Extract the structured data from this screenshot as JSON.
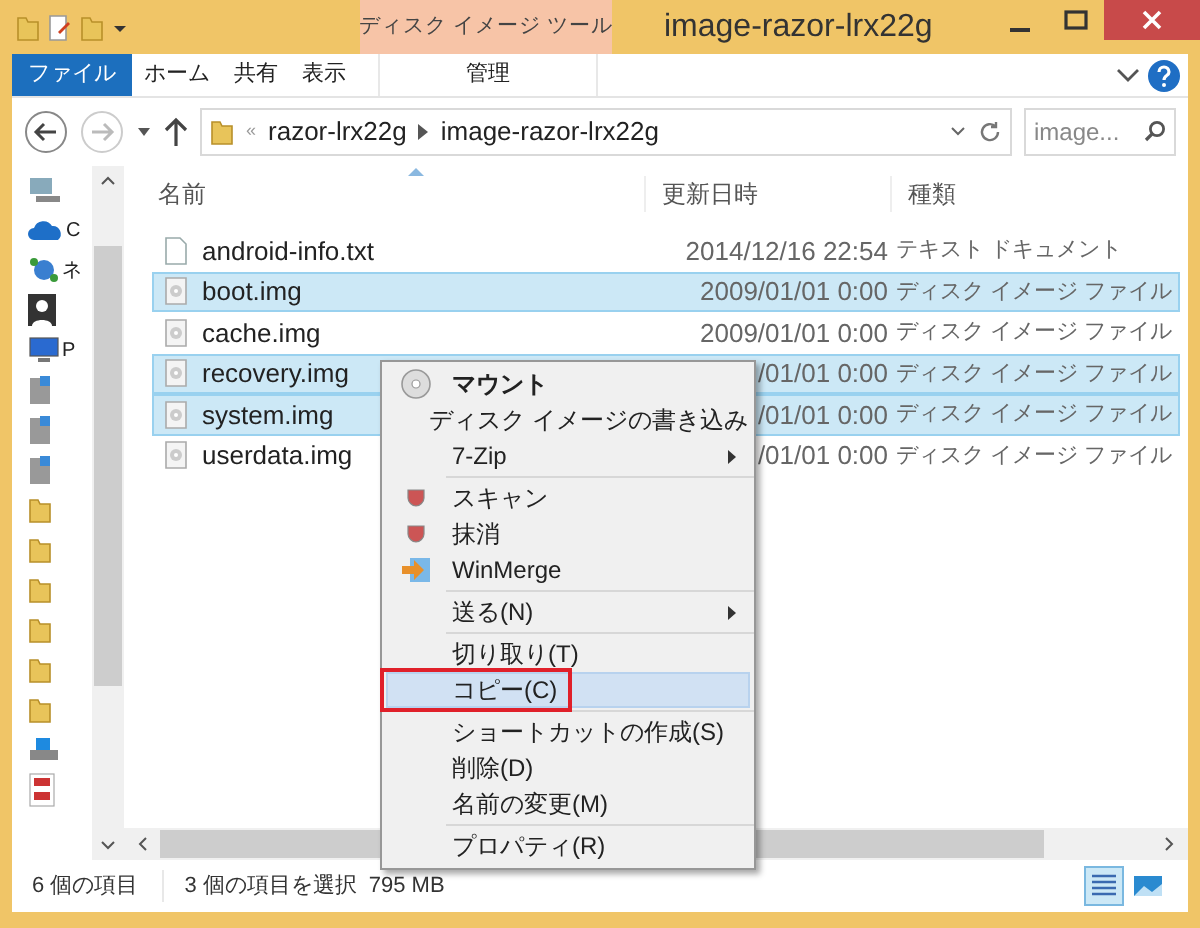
{
  "window": {
    "title": "image-razor-lrx22g",
    "context_tab": "ディスク イメージ ツール"
  },
  "ribbon_tabs": [
    {
      "label": "ファイル",
      "kind": "file"
    },
    {
      "label": "ホーム",
      "kind": "tab"
    },
    {
      "label": "共有",
      "kind": "tab"
    },
    {
      "label": "表示",
      "kind": "tab"
    },
    {
      "label": "管理",
      "kind": "context"
    }
  ],
  "address": {
    "overflow": "«",
    "path": [
      "razor-lrx22g",
      "image-razor-lrx22g"
    ],
    "search_placeholder": "image..."
  },
  "nav_labels": [
    "C",
    "ネ",
    "P"
  ],
  "columns": [
    "名前",
    "更新日時",
    "種類"
  ],
  "rows": [
    {
      "name": "android-info.txt",
      "kind": "text",
      "date": "2014/12/16 22:54",
      "type": "テキスト ドキュメント",
      "selected": false
    },
    {
      "name": "boot.img",
      "kind": "image",
      "date": "2009/01/01 0:00",
      "type": "ディスク イメージ ファイル",
      "selected": true
    },
    {
      "name": "cache.img",
      "kind": "image",
      "date": "2009/01/01 0:00",
      "type": "ディスク イメージ ファイル",
      "selected": false
    },
    {
      "name": "recovery.img",
      "kind": "image",
      "date": "/01/01 0:00",
      "type": "ディスク イメージ ファイル",
      "selected": true
    },
    {
      "name": "system.img",
      "kind": "image",
      "date": "/01/01 0:00",
      "type": "ディスク イメージ ファイル",
      "selected": true
    },
    {
      "name": "userdata.img",
      "kind": "image",
      "date": "/01/01 0:00",
      "type": "ディスク イメージ ファイル",
      "selected": false
    }
  ],
  "context_menu": [
    {
      "kind": "item",
      "label": "マウント",
      "bold": true,
      "submenu": false,
      "selected": false
    },
    {
      "kind": "item",
      "label": "ディスク イメージの書き込み",
      "bold": false,
      "submenu": false,
      "selected": false
    },
    {
      "kind": "item",
      "label": "7-Zip",
      "bold": false,
      "submenu": true,
      "selected": false
    },
    {
      "kind": "separator"
    },
    {
      "kind": "item",
      "label": "スキャン",
      "bold": false,
      "submenu": false,
      "selected": false
    },
    {
      "kind": "item",
      "label": "抹消",
      "bold": false,
      "submenu": false,
      "selected": false
    },
    {
      "kind": "item",
      "label": "WinMerge",
      "bold": false,
      "submenu": false,
      "selected": false
    },
    {
      "kind": "separator"
    },
    {
      "kind": "item",
      "label": "送る(N)",
      "bold": false,
      "submenu": true,
      "selected": false
    },
    {
      "kind": "separator"
    },
    {
      "kind": "item",
      "label": "切り取り(T)",
      "bold": false,
      "submenu": false,
      "selected": false
    },
    {
      "kind": "item",
      "label": "コピー(C)",
      "bold": false,
      "submenu": false,
      "selected": true,
      "annotated": true
    },
    {
      "kind": "separator"
    },
    {
      "kind": "item",
      "label": "ショートカットの作成(S)",
      "bold": false,
      "submenu": false,
      "selected": false
    },
    {
      "kind": "item",
      "label": "削除(D)",
      "bold": false,
      "submenu": false,
      "selected": false
    },
    {
      "kind": "item",
      "label": "名前の変更(M)",
      "bold": false,
      "submenu": false,
      "selected": false
    },
    {
      "kind": "separator"
    },
    {
      "kind": "item",
      "label": "プロパティ(R)",
      "bold": false,
      "submenu": false,
      "selected": false
    }
  ],
  "status_bar": {
    "count": "6 個の項目",
    "selection": "3 個の項目を選択",
    "size": "795 MB"
  }
}
